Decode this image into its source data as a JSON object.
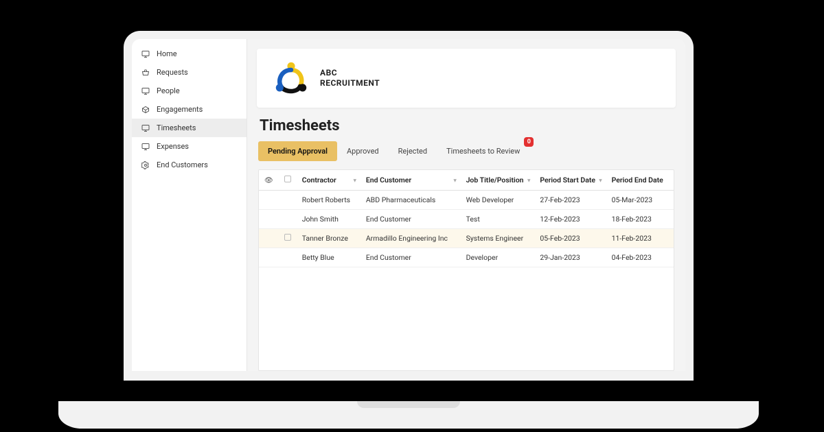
{
  "brand": {
    "line1": "ABC",
    "line2": "RECRUITMENT"
  },
  "nav": {
    "home": "Home",
    "requests": "Requests",
    "people": "People",
    "engagements": "Engagements",
    "timesheets": "Timesheets",
    "expenses": "Expenses",
    "end_customers": "End Customers"
  },
  "page_title": "Timesheets",
  "tabs": {
    "pending": "Pending Approval",
    "approved": "Approved",
    "rejected": "Rejected",
    "review": "Timesheets to Review",
    "review_badge": "0"
  },
  "columns": {
    "contractor": "Contractor",
    "end_customer": "End Customer",
    "job_title": "Job Title/Position",
    "period_start": "Period Start Date",
    "period_end": "Period End Date"
  },
  "rows": [
    {
      "contractor": "Robert Roberts",
      "end_customer": "ABD Pharmaceuticals",
      "job_title": "Web Developer",
      "period_start": "27-Feb-2023",
      "period_end": "05-Mar-2023",
      "hl": false
    },
    {
      "contractor": "John Smith",
      "end_customer": "End Customer",
      "job_title": "Test",
      "period_start": "12-Feb-2023",
      "period_end": "18-Feb-2023",
      "hl": false
    },
    {
      "contractor": "Tanner Bronze",
      "end_customer": "Armadillo Engineering Inc",
      "job_title": "Systems Engineer",
      "period_start": "05-Feb-2023",
      "period_end": "11-Feb-2023",
      "hl": true
    },
    {
      "contractor": "Betty Blue",
      "end_customer": "End Customer",
      "job_title": "Developer",
      "period_start": "29-Jan-2023",
      "period_end": "04-Feb-2023",
      "hl": false
    }
  ]
}
